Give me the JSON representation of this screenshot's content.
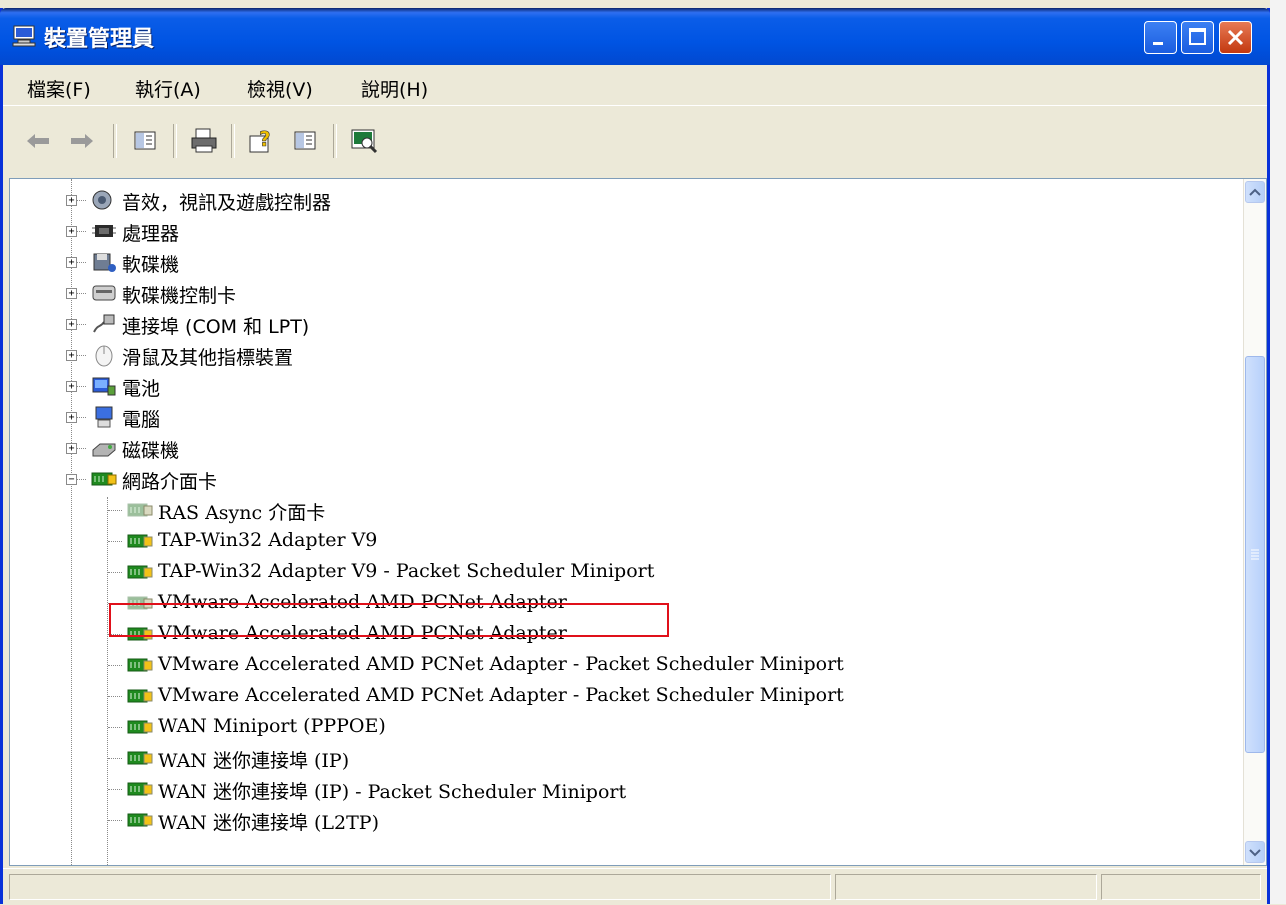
{
  "window": {
    "title": "裝置管理員",
    "controls": {
      "minimize": "minimize",
      "maximize": "maximize",
      "close": "close"
    }
  },
  "menu": {
    "items": [
      {
        "label": "檔案(F)"
      },
      {
        "label": "執行(A)"
      },
      {
        "label": "檢視(V)"
      },
      {
        "label": "說明(H)"
      }
    ]
  },
  "toolbar": {
    "buttons": [
      {
        "name": "back-arrow-icon"
      },
      {
        "name": "forward-arrow-icon"
      },
      {
        "name": "show-hide-tree-icon"
      },
      {
        "name": "print-icon"
      },
      {
        "name": "help-icon"
      },
      {
        "name": "properties-icon"
      },
      {
        "name": "scan-hardware-icon"
      }
    ]
  },
  "tree": {
    "categories": [
      {
        "label": "音效，視訊及遊戲控制器",
        "icon": "speaker-icon"
      },
      {
        "label": "處理器",
        "icon": "processor-icon"
      },
      {
        "label": "軟碟機",
        "icon": "floppy-drive-icon"
      },
      {
        "label": "軟碟機控制卡",
        "icon": "floppy-controller-icon"
      },
      {
        "label": "連接埠 (COM 和 LPT)",
        "icon": "port-icon"
      },
      {
        "label": "滑鼠及其他指標裝置",
        "icon": "mouse-icon"
      },
      {
        "label": "電池",
        "icon": "battery-icon"
      },
      {
        "label": "電腦",
        "icon": "computer-icon"
      },
      {
        "label": "磁碟機",
        "icon": "disk-drive-icon"
      },
      {
        "label": "網路介面卡",
        "icon": "network-card-icon",
        "expanded": true
      }
    ],
    "adapters": [
      {
        "label": "RAS Async 介面卡",
        "disabled": true
      },
      {
        "label": "TAP-Win32 Adapter V9",
        "disabled": false
      },
      {
        "label": "TAP-Win32 Adapter V9 - Packet Scheduler Miniport",
        "disabled": false
      },
      {
        "label": "VMware Accelerated AMD PCNet Adapter",
        "disabled": true,
        "highlighted": true
      },
      {
        "label": "VMware Accelerated AMD PCNet Adapter",
        "disabled": false
      },
      {
        "label": "VMware Accelerated AMD PCNet Adapter - Packet Scheduler Miniport",
        "disabled": false
      },
      {
        "label": "VMware Accelerated AMD PCNet Adapter - Packet Scheduler Miniport",
        "disabled": false
      },
      {
        "label": "WAN Miniport (PPPOE)",
        "disabled": false
      },
      {
        "label": "WAN 迷你連接埠 (IP)",
        "disabled": false
      },
      {
        "label": "WAN 迷你連接埠 (IP) - Packet Scheduler Miniport",
        "disabled": false
      },
      {
        "label": "WAN 迷你連接埠 (L2TP)",
        "disabled": false
      }
    ]
  },
  "colors": {
    "titlebar": "#0054e3",
    "highlight_border": "#e0101a",
    "nic_green": "#1f8a1f",
    "nic_disabled": "#9bbf9b"
  }
}
